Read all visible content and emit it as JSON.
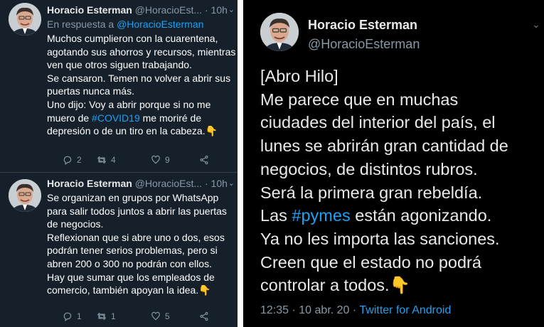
{
  "left_column": {
    "tweet1": {
      "name": "Horacio Esterman",
      "handle": "@HoracioEst...",
      "separator": "·",
      "time": "10h",
      "reply_prefix": "En respuesta a",
      "reply_handle": "@HoracioEsterman",
      "lines": [
        "Muchos cumplieron con la cuarentena,",
        "agotando sus ahorros y recursos, mientras",
        "ven que otros siguen trabajando.",
        "Se cansaron. Temen no volver a abrir sus",
        "puertas nunca más.",
        "Uno dijo: Voy a abrir porque si no me"
      ],
      "line7_before": "muero de",
      "hashtag": "#COVID19",
      "line7_after": "me moriré de",
      "line8": "depresión o de un tiro en la cabeza.",
      "emoji": "👇",
      "replies": "2",
      "retweets": "4",
      "likes": "9"
    },
    "tweet2": {
      "name": "Horacio Esterman",
      "handle": "@HoracioEst...",
      "separator": "·",
      "time": "10h",
      "lines": [
        "Se organizan en grupos por WhatsApp",
        "para salir todos juntos a abrir las puertas",
        "de negocios.",
        "Reflexionan que si abre uno o dos, esos",
        "podrán tener serios problemas, pero si",
        "abren 200 o  300 no podrán con ellos.",
        "Hay que sumar que los empleados de"
      ],
      "last_line": "comercio, también apoyan la idea.",
      "emoji": "👇",
      "replies": "1",
      "retweets": "1",
      "likes": "5"
    }
  },
  "right_column": {
    "name": "Horacio Esterman",
    "handle": "@HoracioEsterman",
    "lines": [
      "[Abro Hilo]",
      "Me parece que en muchas",
      "ciudades del interior del país, el",
      "lunes se abrirán gran cantidad de",
      "negocios, de distintos rubros.",
      "Será la primera gran rebeldía."
    ],
    "line7_before": "Las",
    "hashtag": "#pymes",
    "line7_after": "están agonizando.",
    "lines_end": [
      "Ya no les importa las sanciones.",
      "Creen que el estado no podrá"
    ],
    "last_line": "controlar a todos.",
    "emoji": "👇",
    "time": "12:35",
    "separator": "·",
    "date": "10 abr. 20",
    "separator2": "·",
    "client": "Twitter for Android"
  },
  "colors": {
    "dim_bg": "#15202b",
    "black_bg": "#000000",
    "accent": "#1da1f2",
    "muted": "#8899a6"
  },
  "icons": [
    "reply-icon",
    "retweet-icon",
    "like-icon",
    "share-icon",
    "chevron-down-icon"
  ]
}
